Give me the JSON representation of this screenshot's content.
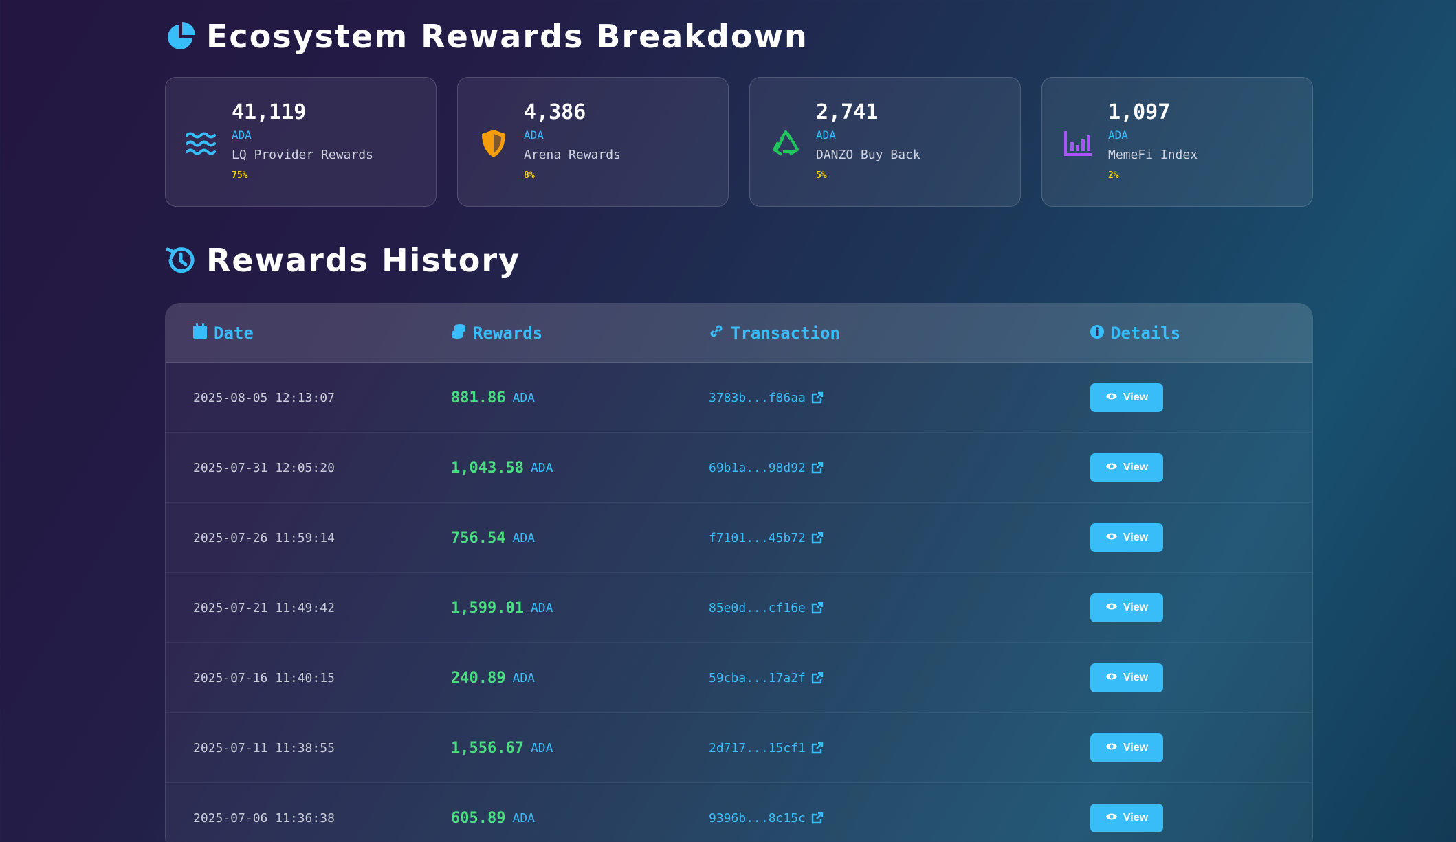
{
  "breakdown": {
    "title": "Ecosystem Rewards Breakdown",
    "cards": [
      {
        "value": "41,119",
        "unit": "ADA",
        "label": "LQ Provider Rewards",
        "percent": "75%",
        "icon": "waves-icon",
        "color": "#38bdf8"
      },
      {
        "value": "4,386",
        "unit": "ADA",
        "label": "Arena Rewards",
        "percent": "8%",
        "icon": "shield-icon",
        "color": "#f59e0b"
      },
      {
        "value": "2,741",
        "unit": "ADA",
        "label": "DANZO Buy Back",
        "percent": "5%",
        "icon": "recycle-icon",
        "color": "#22c55e"
      },
      {
        "value": "1,097",
        "unit": "ADA",
        "label": "MemeFi Index",
        "percent": "2%",
        "icon": "chart-bars-icon",
        "color": "#a855f7"
      }
    ]
  },
  "history": {
    "title": "Rewards History",
    "headers": {
      "date": "Date",
      "rewards": "Rewards",
      "transaction": "Transaction",
      "details": "Details"
    },
    "view_label": "View",
    "rows": [
      {
        "date": "2025-08-05 12:13:07",
        "amount": "881.86",
        "unit": "ADA",
        "tx": "3783b...f86aa"
      },
      {
        "date": "2025-07-31 12:05:20",
        "amount": "1,043.58",
        "unit": "ADA",
        "tx": "69b1a...98d92"
      },
      {
        "date": "2025-07-26 11:59:14",
        "amount": "756.54",
        "unit": "ADA",
        "tx": "f7101...45b72"
      },
      {
        "date": "2025-07-21 11:49:42",
        "amount": "1,599.01",
        "unit": "ADA",
        "tx": "85e0d...cf16e"
      },
      {
        "date": "2025-07-16 11:40:15",
        "amount": "240.89",
        "unit": "ADA",
        "tx": "59cba...17a2f"
      },
      {
        "date": "2025-07-11 11:38:55",
        "amount": "1,556.67",
        "unit": "ADA",
        "tx": "2d717...15cf1"
      },
      {
        "date": "2025-07-06 11:36:38",
        "amount": "605.89",
        "unit": "ADA",
        "tx": "9396b...8c15c"
      }
    ]
  },
  "colors": {
    "accent": "#38bdf8",
    "positive": "#4ade80",
    "percent": "#ffd400"
  }
}
